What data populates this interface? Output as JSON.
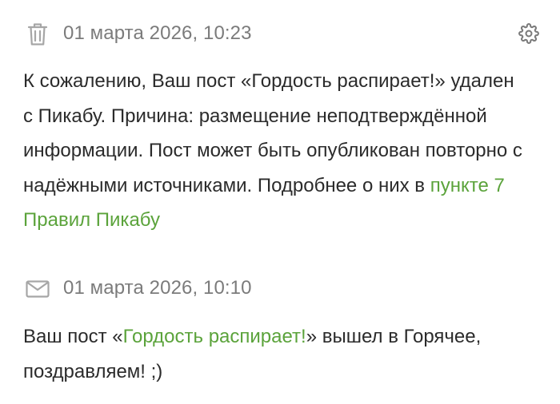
{
  "notifications": [
    {
      "icon": "trash-icon",
      "date": "01 марта 2026, 10:23",
      "text_before": "К сожалению, Ваш пост «Гордость распирает!» удален с Пикабу. Причина: размещение неподтверждённой информации. Пост может быть опубликован повторно с надёжными источниками. Подробнее о них в ",
      "link_text": "пункте 7 Правил Пикабу",
      "text_after": ""
    },
    {
      "icon": "envelope-icon",
      "date": "01 марта 2026, 10:10",
      "text_before": "Ваш пост «",
      "link_text": "Гордость распирает!",
      "text_after": "» вышел в Горячее, поздравляем! ;)"
    }
  ],
  "settings_icon": "gear-icon",
  "colors": {
    "link": "#5ba33b",
    "date": "#7b7b7b",
    "icon": "#a6a6a6",
    "text": "#2b2b2b"
  }
}
